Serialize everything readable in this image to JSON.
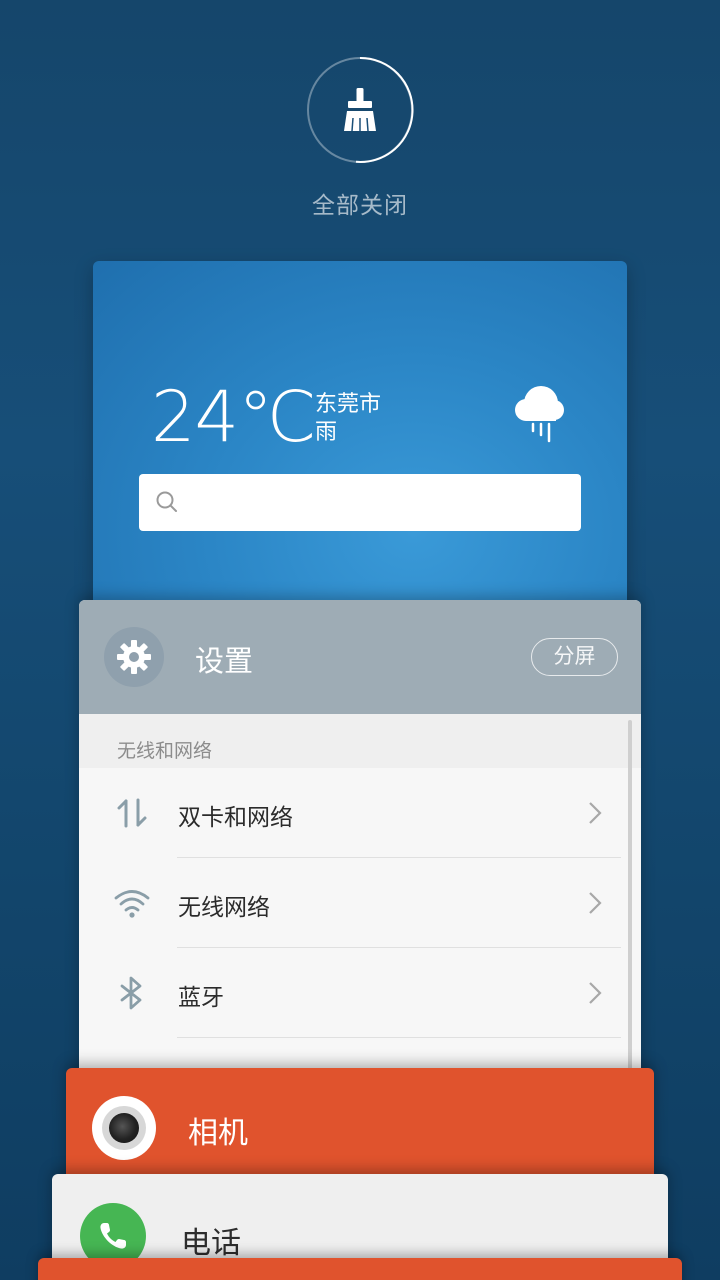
{
  "clean_all": {
    "label": "全部关闭",
    "icon": "broom-icon"
  },
  "weather_card": {
    "temperature": "24℃",
    "city": "东莞市",
    "condition": "雨",
    "condition_icon": "rain-cloud-icon",
    "search_icon": "search-icon",
    "search_placeholder": ""
  },
  "settings_card": {
    "app_icon": "gear-icon",
    "title": "设置",
    "split_label": "分屏",
    "section": "无线和网络",
    "rows": [
      {
        "label": "双卡和网络",
        "icon": "data-arrows-icon"
      },
      {
        "label": "无线网络",
        "icon": "wifi-icon"
      },
      {
        "label": "蓝牙",
        "icon": "bluetooth-icon"
      }
    ]
  },
  "camera_card": {
    "title": "相机",
    "icon": "camera-icon",
    "color": "#e0532d"
  },
  "phone_card": {
    "title": "电话",
    "icon": "phone-icon",
    "color": "#46b653"
  },
  "colors": {
    "background": "#174e78",
    "weather": "#2b86c6",
    "settings_header": "#9eacb5"
  }
}
